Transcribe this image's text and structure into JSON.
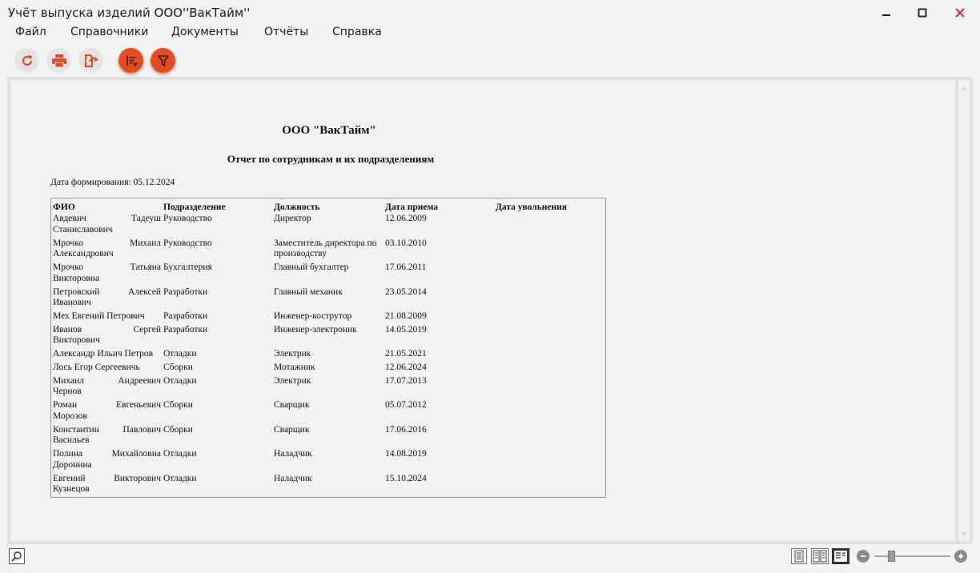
{
  "window": {
    "title": "Учёт выпуска изделий ООО''ВакТайм''",
    "close_color": "#e81123"
  },
  "menu": {
    "items": [
      "Файл",
      "Справочники",
      "Документы",
      "Отчёты",
      "Справка"
    ]
  },
  "toolbar": {
    "accent": "#e84a1c",
    "buttons": [
      "refresh-icon",
      "print-icon",
      "export-icon",
      "sort-icon",
      "filter-icon"
    ]
  },
  "report": {
    "company": "ООО \"ВакТайм\"",
    "title": "Отчет по сотрудникам и их подразделениям",
    "date_line": "Дата формирования: 05.12.2024",
    "columns": [
      "ФИО",
      "Подразделение",
      "Должность",
      "Дата приема",
      "Дата увольнения"
    ],
    "rows": [
      {
        "fio1": "Авдевич",
        "fio2": "Тадеуш",
        "fio3": "Станиславович",
        "dept": "Руководство",
        "pos": "Директор",
        "pos2": "",
        "hired": "12.06.2009",
        "fired": ""
      },
      {
        "fio1": "Мрочко",
        "fio2": "Михаил",
        "fio3": "Александрович",
        "dept": "Руководство",
        "pos": "Заместитель директора по",
        "pos2": "производству",
        "hired": "03.10.2010",
        "fired": ""
      },
      {
        "fio1": "Мрочко",
        "fio2": "Татьяна",
        "fio3": "Викторовна",
        "dept": "Бухгалтерия",
        "pos": "Главный бухгалтер",
        "pos2": "",
        "hired": "17.06.2011",
        "fired": ""
      },
      {
        "fio1": "Петровский",
        "fio2": "Алексей",
        "fio3": "Иванович",
        "dept": "Разработки",
        "pos": "Главный механик",
        "pos2": "",
        "hired": "23.05.2014",
        "fired": ""
      },
      {
        "fio1": "Мех Евгений Петрович",
        "fio2": "",
        "fio3": "",
        "dept": "Разработки",
        "pos": "Инженер-кострутор",
        "pos2": "",
        "hired": "21.08.2009",
        "fired": ""
      },
      {
        "fio1": "Иванов",
        "fio2": "Сергей",
        "fio3": "Викторович",
        "dept": "Разработки",
        "pos": "Инженер-электроник",
        "pos2": "",
        "hired": "14.05.2019",
        "fired": ""
      },
      {
        "fio1": "Александр Ильич Петров",
        "fio2": "",
        "fio3": "",
        "dept": "Отладки",
        "pos": "Электрик",
        "pos2": "",
        "hired": "21.05.2021",
        "fired": ""
      },
      {
        "fio1": "Лось Егор Сергеевичь",
        "fio2": "",
        "fio3": "",
        "dept": "Сборки",
        "pos": "Мотажник",
        "pos2": "",
        "hired": "12.06.2024",
        "fired": ""
      },
      {
        "fio1": "Михаил",
        "fio2": "Андреевич",
        "fio3": "Чернов",
        "dept": "Отладки",
        "pos": "Электрик",
        "pos2": "",
        "hired": "17.07.2013",
        "fired": ""
      },
      {
        "fio1": "Роман",
        "fio2": "Евгеньевич",
        "fio3": "Морозов",
        "dept": "Сборки",
        "pos": "Сварщик",
        "pos2": "",
        "hired": "05.07.2012",
        "fired": ""
      },
      {
        "fio1": "Константин",
        "fio2": "Павлович",
        "fio3": "Васильев",
        "dept": "Сборки",
        "pos": "Сварщик",
        "pos2": "",
        "hired": "17.06.2016",
        "fired": ""
      },
      {
        "fio1": "Полина",
        "fio2": "Михайловна",
        "fio3": "Доронина",
        "dept": "Отладки",
        "pos": "Наладчик",
        "pos2": "",
        "hired": "14.08.2019",
        "fired": ""
      },
      {
        "fio1": "Евгений",
        "fio2": "Викторович",
        "fio3": "Кузнецов",
        "dept": "Отладки",
        "pos": "Наладчик",
        "pos2": "",
        "hired": "15.10.2024",
        "fired": ""
      }
    ]
  },
  "statusbar": {
    "zoom_fraction": 0.2,
    "icons": [
      "search-icon",
      "single-page-icon",
      "two-page-icon",
      "page-width-icon",
      "zoom-out-icon",
      "zoom-in-icon"
    ]
  }
}
